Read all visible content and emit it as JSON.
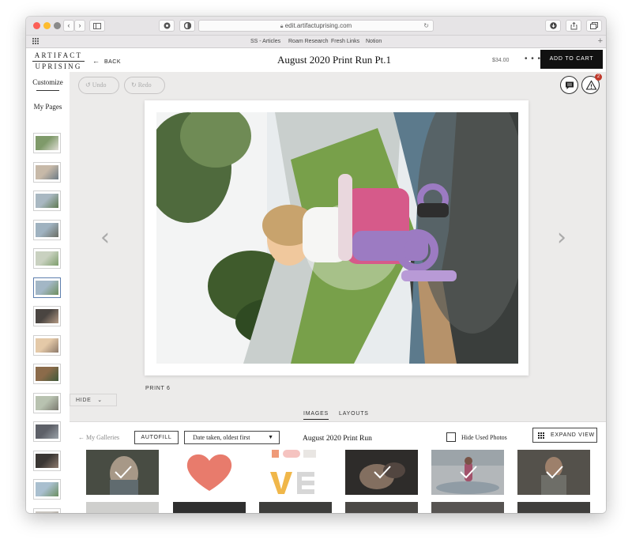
{
  "browser": {
    "url": "edit.artifactuprising.com",
    "favorites": [
      "SS - Articles",
      "Roam Research",
      "Fresh Links",
      "Notion"
    ]
  },
  "header": {
    "logo_top": "ARTIFACT",
    "logo_bottom": "UPRISING",
    "back_label": "BACK",
    "title": "August 2020 Print Run Pt.1",
    "price": "$34.00",
    "more_label": "• • •",
    "add_to_cart": "ADD TO CART"
  },
  "sidebar": {
    "customize": "Customize",
    "my_pages": "My Pages",
    "selected_index": 5,
    "thumb_count": 14
  },
  "toolbar": {
    "undo": "Undo",
    "redo": "Redo",
    "notification_count": "2"
  },
  "canvas": {
    "print_label": "PRINT 6",
    "hide_label": "HIDE"
  },
  "tray": {
    "tabs": [
      "IMAGES",
      "LAYOUTS"
    ],
    "active_tab": "IMAGES",
    "my_galleries": "My Galleries",
    "autofill": "AUTOFILL",
    "sort_value": "Date taken, oldest first",
    "gallery_title": "August 2020 Print Run",
    "hide_used": "Hide Used Photos",
    "expand_view": "EXPAND VIEW",
    "used_flags": [
      true,
      false,
      false,
      true,
      true,
      true
    ]
  },
  "colors": {
    "accent_dark": "#111111",
    "canvas_bg": "#ecebea",
    "badge": "#c0392b",
    "selected_thumb_border": "#5e7fae"
  }
}
